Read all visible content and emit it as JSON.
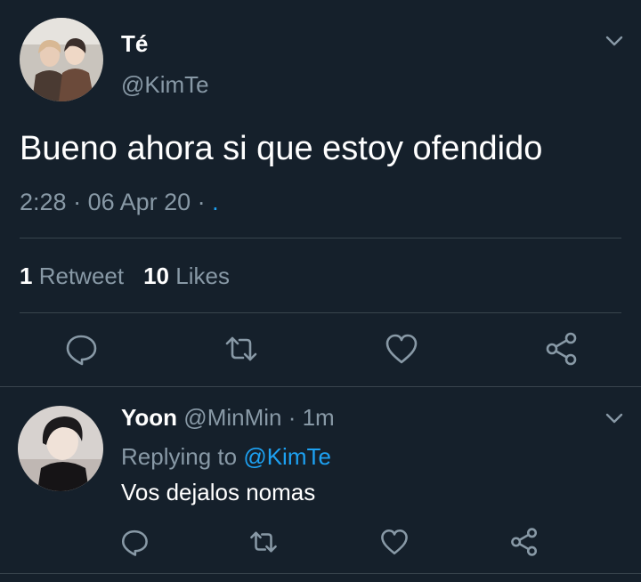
{
  "colors": {
    "background": "#15202b",
    "text_primary": "#ffffff",
    "text_secondary": "#8899a6",
    "accent": "#1da1f2",
    "divider": "#38444d"
  },
  "tweet": {
    "author": {
      "display_name": "Té",
      "handle": "@KimTe",
      "avatar_icon": "avatar-photo"
    },
    "text": "Bueno ahora si que estoy ofendido",
    "time": "2:28",
    "separator": " · ",
    "date": "06 Apr 20",
    "source": ".",
    "stats": {
      "retweets_count": "1",
      "retweets_label": "Retweet",
      "likes_count": "10",
      "likes_label": "Likes"
    },
    "actions": {
      "reply_icon": "reply-icon",
      "retweet_icon": "retweet-icon",
      "like_icon": "heart-icon",
      "share_icon": "share-icon"
    }
  },
  "reply": {
    "author": {
      "display_name": "Yoon",
      "handle": "@MinMin",
      "avatar_icon": "avatar-photo"
    },
    "separator": " · ",
    "time": "1m",
    "replying_label": "Replying to",
    "replying_to": "@KimTe",
    "text": "Vos dejalos nomas"
  }
}
